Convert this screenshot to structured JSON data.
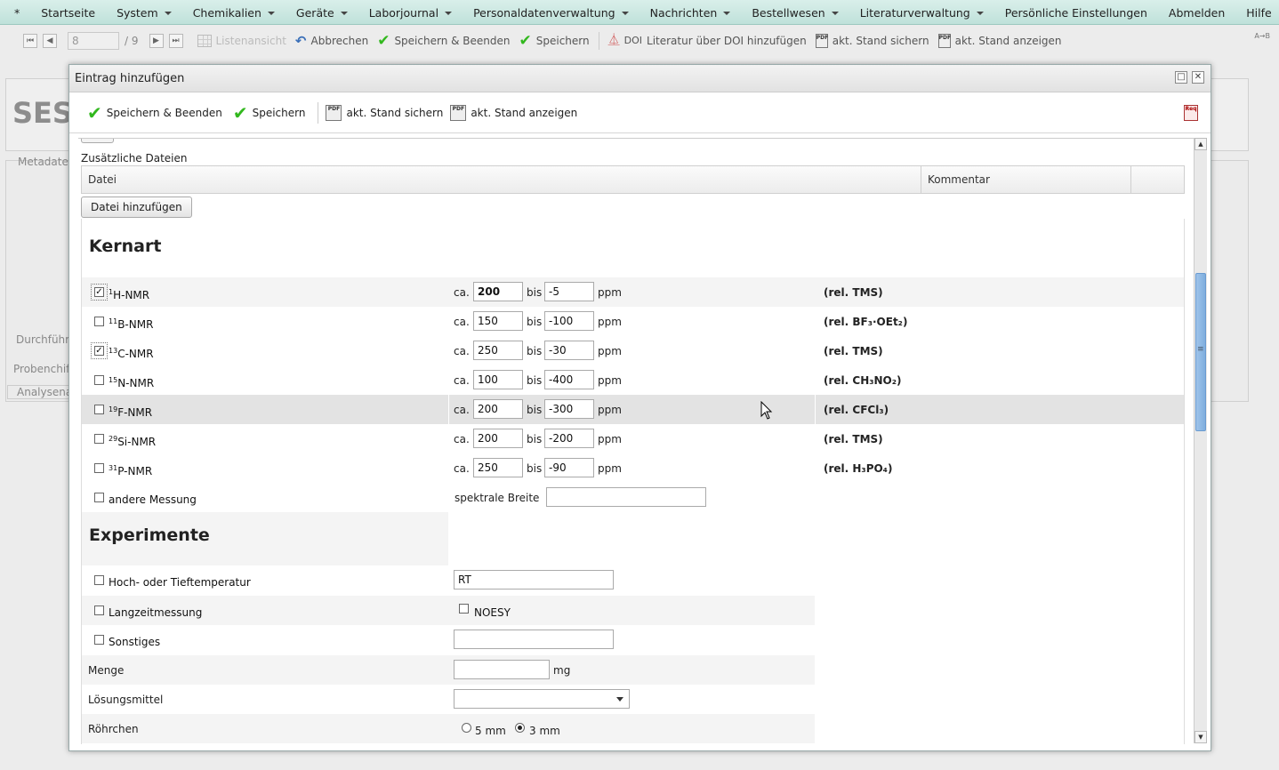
{
  "menu": {
    "items": [
      {
        "label": "*",
        "sub": false
      },
      {
        "label": "Startseite",
        "sub": false
      },
      {
        "label": "System",
        "sub": true
      },
      {
        "label": "Chemikalien",
        "sub": true
      },
      {
        "label": "Geräte",
        "sub": true
      },
      {
        "label": "Laborjournal",
        "sub": true
      },
      {
        "label": "Personaldatenverwaltung",
        "sub": true
      },
      {
        "label": "Nachrichten",
        "sub": true
      },
      {
        "label": "Bestellwesen",
        "sub": true
      },
      {
        "label": "Literaturverwaltung",
        "sub": true
      },
      {
        "label": "Persönliche Einstellungen",
        "sub": false
      },
      {
        "label": "Abmelden",
        "sub": false
      },
      {
        "label": "Hilfe",
        "sub": false
      }
    ]
  },
  "toolbar": {
    "record_value": "8",
    "record_total": "/ 9",
    "list_view": "Listenansicht",
    "cancel": "Abbrechen",
    "save_close": "Speichern & Beenden",
    "save": "Speichern",
    "doi_tag": "DOI",
    "doi_add": "Literatur über DOI hinzufügen",
    "save_state": "akt. Stand sichern",
    "show_state": "akt. Stand anzeigen",
    "arrow_hint": "A→B"
  },
  "background": {
    "title": "SES",
    "metadata": "Metadaten",
    "durchfuehrung": "Durchführu",
    "probenchiffre": "Probenchiffi",
    "analysename": "Analysena"
  },
  "dialog": {
    "title": "Eintrag hinzufügen",
    "save_close": "Speichern & Beenden",
    "save": "Speichern",
    "save_state": "akt. Stand sichern",
    "show_state": "akt. Stand anzeigen",
    "req_icon_text": "Req",
    "pdf_icon_text": "PDF"
  },
  "files": {
    "title": "Zusätzliche Dateien",
    "col_file": "Datei",
    "col_comment": "Kommentar",
    "add_button": "Datei hinzufügen"
  },
  "kernart": {
    "heading": "Kernart",
    "ca": "ca.",
    "bis": "bis",
    "unit": "ppm",
    "nuclei": [
      {
        "mass": "1",
        "name": "H-NMR",
        "checked": true,
        "from": "200",
        "to": "-5",
        "ref": "(rel. TMS)",
        "ref_sub": ""
      },
      {
        "mass": "11",
        "name": "B-NMR",
        "checked": false,
        "from": "150",
        "to": "-100",
        "ref": "(rel. BF₃·OEt₂)",
        "ref_sub": ""
      },
      {
        "mass": "13",
        "name": "C-NMR",
        "checked": true,
        "from": "250",
        "to": "-30",
        "ref": "(rel. TMS)",
        "ref_sub": ""
      },
      {
        "mass": "15",
        "name": "N-NMR",
        "checked": false,
        "from": "100",
        "to": "-400",
        "ref": "(rel. CH₃NO₂)",
        "ref_sub": ""
      },
      {
        "mass": "19",
        "name": "F-NMR",
        "checked": false,
        "from": "200",
        "to": "-300",
        "ref": "(rel. CFCl₃)",
        "ref_sub": ""
      },
      {
        "mass": "29",
        "name": "Si-NMR",
        "checked": false,
        "from": "200",
        "to": "-200",
        "ref": "(rel. TMS)",
        "ref_sub": ""
      },
      {
        "mass": "31",
        "name": "P-NMR",
        "checked": false,
        "from": "250",
        "to": "-90",
        "ref": "(rel. H₃PO₄)",
        "ref_sub": ""
      }
    ],
    "other_label": "andere Messung",
    "spectral_width_label": "spektrale Breite",
    "spectral_width_value": ""
  },
  "experimente": {
    "heading": "Experimente",
    "temp_label": "Hoch- oder Tieftemperatur",
    "temp_value": "RT",
    "long_label": "Langzeitmessung",
    "noesy_label": "NOESY",
    "other_label": "Sonstiges",
    "other_value": "",
    "amount_label": "Menge",
    "amount_value": "",
    "amount_unit": "mg",
    "solvent_label": "Lösungsmittel",
    "solvent_value": "",
    "tube_label": "Röhrchen",
    "tube_options": [
      "5 mm",
      "3 mm"
    ],
    "tube_selected": "3 mm"
  },
  "colors": {
    "menu_bg": "#c8e7e0",
    "check_green": "#32b81e",
    "scroll_thumb": "#8db8e4"
  }
}
